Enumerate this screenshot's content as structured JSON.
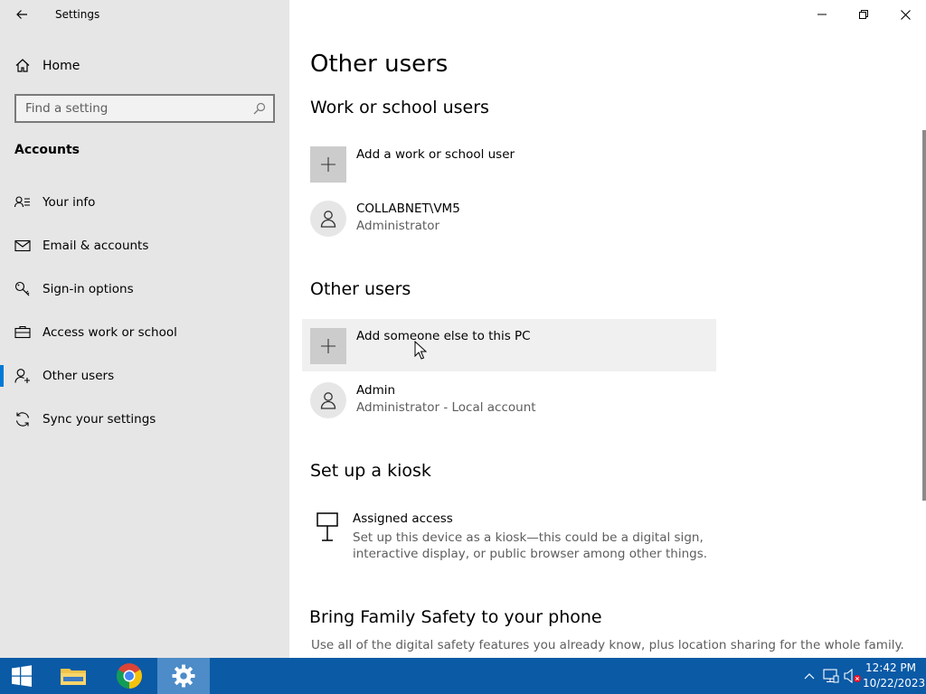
{
  "window": {
    "title": "Settings"
  },
  "sidebar": {
    "home_label": "Home",
    "search_placeholder": "Find a setting",
    "section_label": "Accounts",
    "items": [
      {
        "label": "Your info",
        "icon": "your-info-icon"
      },
      {
        "label": "Email & accounts",
        "icon": "email-icon"
      },
      {
        "label": "Sign-in options",
        "icon": "key-icon"
      },
      {
        "label": "Access work or school",
        "icon": "briefcase-icon"
      },
      {
        "label": "Other users",
        "icon": "add-person-icon",
        "selected": true
      },
      {
        "label": "Sync your settings",
        "icon": "sync-icon"
      }
    ]
  },
  "main": {
    "page_title": "Other users",
    "work_school": {
      "heading": "Work or school users",
      "add_label": "Add a work or school user",
      "user_name": "COLLABNET\\VM5",
      "user_role": "Administrator"
    },
    "other_users": {
      "heading": "Other users",
      "add_label": "Add someone else to this PC",
      "user_name": "Admin",
      "user_role": "Administrator - Local account"
    },
    "kiosk": {
      "heading": "Set up a kiosk",
      "title": "Assigned access",
      "description": "Set up this device as a kiosk—this could be a digital sign, interactive display, or public browser among other things."
    },
    "family": {
      "heading": "Bring Family Safety to your phone",
      "description": "Use all of the digital safety features you already know, plus location sharing for the whole family."
    }
  },
  "taskbar": {
    "time": "12:42 PM",
    "date": "10/22/2023",
    "apps": [
      "start",
      "file-explorer",
      "chrome",
      "settings"
    ],
    "accent": "#0a5aa6"
  },
  "colors": {
    "sidebar_bg": "#e6e6e6",
    "accent": "#0078d7",
    "tile_bg": "#cccccc"
  }
}
